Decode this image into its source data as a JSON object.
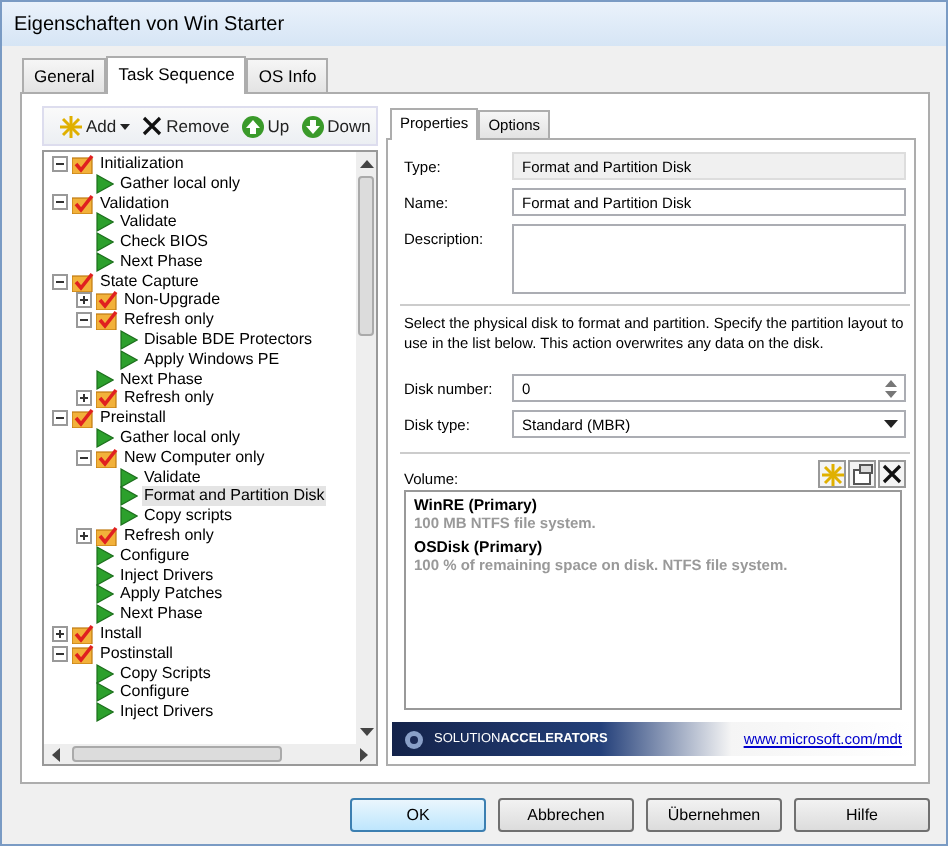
{
  "window": {
    "title": "Eigenschaften von Win Starter"
  },
  "tabs": [
    {
      "label": "General",
      "selected": false
    },
    {
      "label": "Task Sequence",
      "selected": true
    },
    {
      "label": "OS Info",
      "selected": false
    }
  ],
  "toolbar": [
    "Add",
    "Remove",
    "Up",
    "Down"
  ],
  "tree": [
    {
      "kind": "group",
      "label": "Initialization",
      "expanded": true,
      "selected": false,
      "children": [
        {
          "kind": "task",
          "label": "Gather local only",
          "selected": false
        }
      ]
    },
    {
      "kind": "group",
      "label": "Validation",
      "expanded": true,
      "selected": false,
      "children": [
        {
          "kind": "task",
          "label": "Validate",
          "selected": false
        },
        {
          "kind": "task",
          "label": "Check BIOS",
          "selected": false
        },
        {
          "kind": "task",
          "label": "Next Phase",
          "selected": false
        }
      ]
    },
    {
      "kind": "group",
      "label": "State Capture",
      "expanded": true,
      "selected": false,
      "children": [
        {
          "kind": "group",
          "label": "Non-Upgrade",
          "expanded": false,
          "selected": false
        },
        {
          "kind": "group",
          "label": "Refresh only",
          "expanded": true,
          "selected": false,
          "children": [
            {
              "kind": "task",
              "label": "Disable BDE Protectors",
              "selected": false
            },
            {
              "kind": "task",
              "label": "Apply Windows PE",
              "selected": false
            }
          ]
        },
        {
          "kind": "task",
          "label": "Next Phase",
          "selected": false
        },
        {
          "kind": "group",
          "label": "Refresh only",
          "expanded": false,
          "selected": false
        }
      ]
    },
    {
      "kind": "group",
      "label": "Preinstall",
      "expanded": true,
      "selected": false,
      "children": [
        {
          "kind": "task",
          "label": "Gather local only",
          "selected": false
        },
        {
          "kind": "group",
          "label": "New Computer only",
          "expanded": true,
          "selected": false,
          "children": [
            {
              "kind": "task",
              "label": "Validate",
              "selected": false
            },
            {
              "kind": "task",
              "label": "Format and Partition Disk",
              "selected": true
            },
            {
              "kind": "task",
              "label": "Copy scripts",
              "selected": false
            }
          ]
        },
        {
          "kind": "group",
          "label": "Refresh only",
          "expanded": false,
          "selected": false
        },
        {
          "kind": "task",
          "label": "Configure",
          "selected": false
        },
        {
          "kind": "task",
          "label": "Inject Drivers",
          "selected": false
        },
        {
          "kind": "task",
          "label": "Apply Patches",
          "selected": false
        },
        {
          "kind": "task",
          "label": "Next Phase",
          "selected": false
        }
      ]
    },
    {
      "kind": "group",
      "label": "Install",
      "expanded": false,
      "selected": false
    },
    {
      "kind": "group",
      "label": "Postinstall",
      "expanded": true,
      "selected": false,
      "children": [
        {
          "kind": "task",
          "label": "Copy Scripts",
          "selected": false
        },
        {
          "kind": "task",
          "label": "Configure",
          "selected": false
        },
        {
          "kind": "task",
          "label": "Inject Drivers",
          "selected": false
        }
      ]
    }
  ],
  "detail_tabs": [
    {
      "label": "Properties",
      "selected": true
    },
    {
      "label": "Options",
      "selected": false
    }
  ],
  "type": {
    "label": "Type:",
    "value": "Format and Partition Disk"
  },
  "name": {
    "label": "Name:",
    "value": "Format and Partition Disk"
  },
  "description": {
    "label": "Description:"
  },
  "instructions": "Select the physical disk to format and partition.  Specify the partition layout to use in the list below. This action overwrites any data on the disk.",
  "disk_number": {
    "label": "Disk number:",
    "value": "0"
  },
  "disk_type": {
    "label": "Disk type:",
    "value": "Standard (MBR)"
  },
  "volume": {
    "label": "Volume:",
    "items": [
      {
        "title": "WinRE (Primary)",
        "detail": "100 MB NTFS file system."
      },
      {
        "title": "OSDisk (Primary)",
        "detail": "100 % of remaining space on disk. NTFS file system."
      }
    ]
  },
  "banner": {
    "brand": "SOLUTION**ACCELERATORS**",
    "link": "www.microsoft.com/mdt"
  },
  "buttons": [
    "OK",
    "Abbrechen",
    "Übernehmen",
    "Hilfe"
  ]
}
